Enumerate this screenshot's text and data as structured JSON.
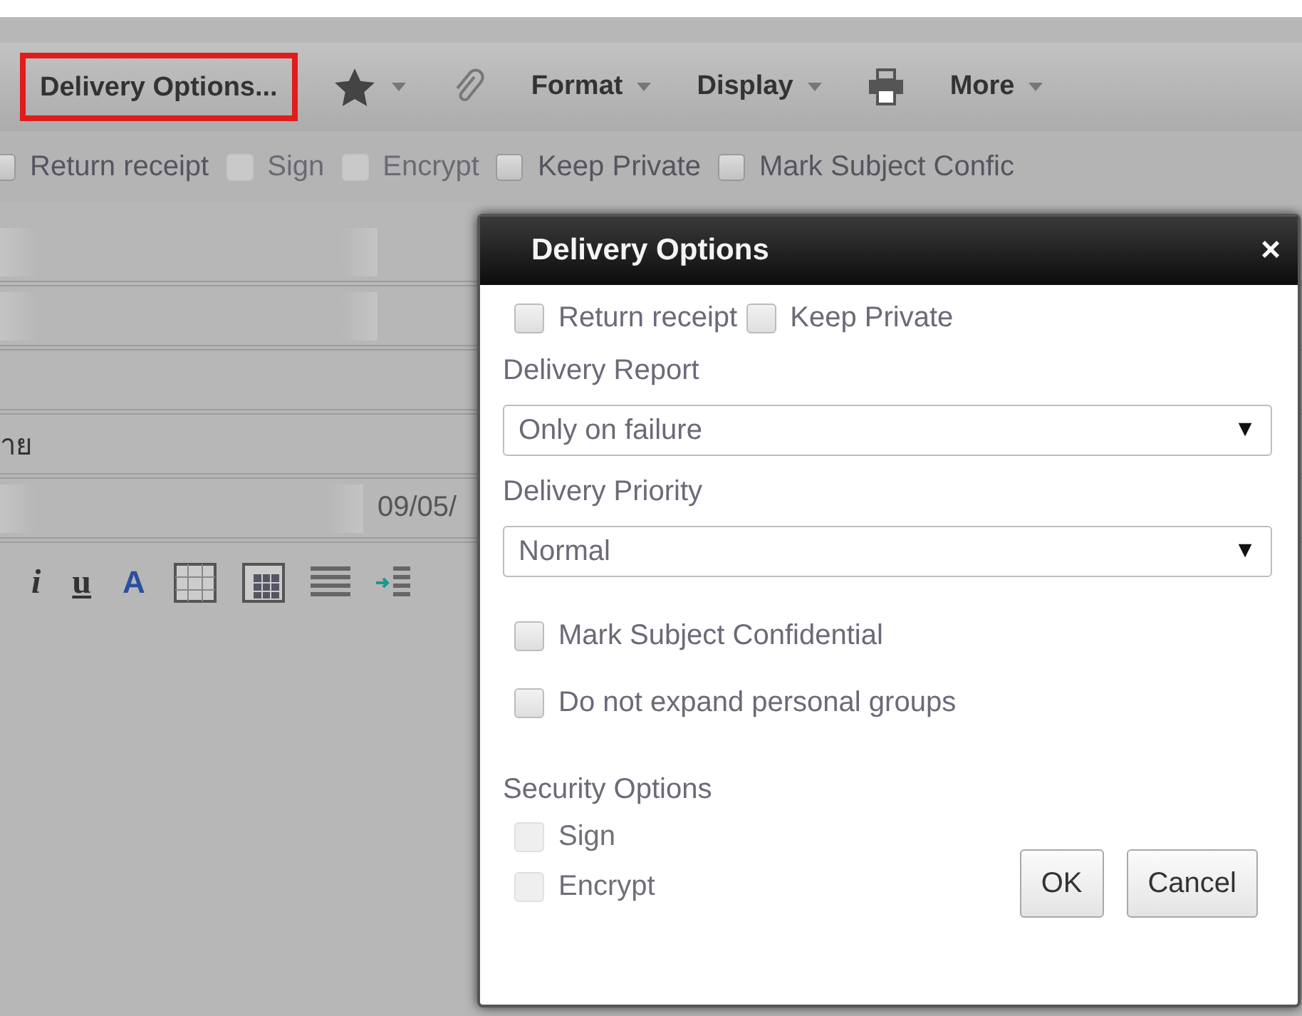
{
  "toolbar": {
    "items": [
      {
        "kind": "button",
        "label": "Delivery Options...",
        "selected": true
      },
      {
        "kind": "star"
      },
      {
        "kind": "paperclip"
      },
      {
        "kind": "menu",
        "label": "Format"
      },
      {
        "kind": "menu",
        "label": "Display"
      },
      {
        "kind": "printer"
      },
      {
        "kind": "menu",
        "label": "More"
      }
    ]
  },
  "option_bar": [
    {
      "label": "Return receipt",
      "checked": false,
      "disabled": false
    },
    {
      "label": "Sign",
      "checked": false,
      "disabled": true
    },
    {
      "label": "Encrypt",
      "checked": false,
      "disabled": true
    },
    {
      "label": "Keep Private",
      "checked": false,
      "disabled": false
    },
    {
      "label": "Mark Subject Confic",
      "checked": false,
      "disabled": false
    }
  ],
  "form_rows": [
    {
      "kind": "address"
    },
    {
      "kind": "address"
    },
    {
      "kind": "plain"
    },
    {
      "kind": "text",
      "value": "าย"
    },
    {
      "kind": "date",
      "value": "09/05/"
    }
  ],
  "format_bar": {
    "letters": [
      "i",
      "u",
      "A"
    ]
  },
  "dialog": {
    "title": "Delivery Options",
    "close": "×",
    "top_options": [
      {
        "label": "Return receipt",
        "checked": false,
        "disabled": false
      },
      {
        "label": "Keep Private",
        "checked": false,
        "disabled": false
      }
    ],
    "selects": [
      {
        "label": "Delivery Report",
        "value": "Only on failure",
        "arrow": "▼"
      },
      {
        "label": "Delivery Priority",
        "value": "Normal",
        "arrow": "▼"
      }
    ],
    "options": [
      {
        "label": "Mark Subject Confidential",
        "checked": false,
        "disabled": false
      },
      {
        "label": "Do not expand personal groups",
        "checked": false,
        "disabled": false
      }
    ],
    "security": {
      "label": "Security Options",
      "options": [
        {
          "label": "Sign",
          "checked": false,
          "disabled": true
        },
        {
          "label": "Encrypt",
          "checked": false,
          "disabled": true
        }
      ]
    },
    "buttons": [
      {
        "label": "OK"
      },
      {
        "label": "Cancel"
      }
    ]
  }
}
